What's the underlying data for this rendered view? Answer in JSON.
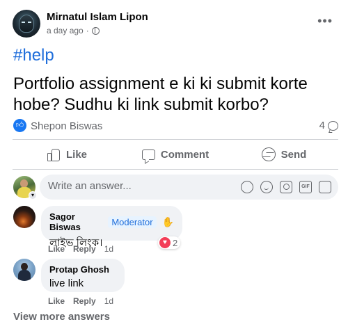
{
  "post": {
    "author": "Mirnatul Islam Lipon",
    "time": "a day ago",
    "privacy_separator": "·",
    "more_icon": "•••",
    "hashtag": "#help",
    "text": "Portfolio assignment e ki ki submit korte hobe? Sudhu ki link submit korbo?"
  },
  "reactions": {
    "reactor": "Shepon Biswas",
    "comment_count": "4"
  },
  "actions": {
    "like": "Like",
    "comment": "Comment",
    "send": "Send"
  },
  "composer": {
    "placeholder": "Write an answer..."
  },
  "comments": [
    {
      "name": "Sagor Biswas",
      "badge": "Moderator",
      "text": "লাইভ লিংক।",
      "like": "Like",
      "reply": "Reply",
      "time": "1d",
      "reaction_count": "2"
    },
    {
      "name": "Protap Ghosh",
      "text": "live link",
      "like": "Like",
      "reply": "Reply",
      "time": "1d"
    }
  ],
  "footer": {
    "view_more": "View more answers"
  },
  "colors": {
    "accent": "#216fdb",
    "like_blue": "#1877f2",
    "heart": "#f33e58",
    "muted": "#65676b"
  }
}
